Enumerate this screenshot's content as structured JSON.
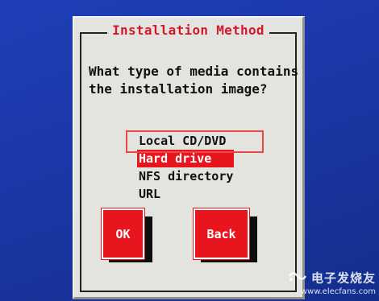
{
  "dialog": {
    "title": "Installation Method",
    "prompt_line1": "What type of media contains",
    "prompt_line2": "the installation image?",
    "options": [
      {
        "label": "Local CD/DVD",
        "selected": false
      },
      {
        "label": "Hard drive",
        "selected": true
      },
      {
        "label": "NFS directory",
        "selected": false
      },
      {
        "label": "URL",
        "selected": false
      }
    ],
    "ok_label": "OK",
    "back_label": "Back"
  },
  "watermark": {
    "brand": "电子发烧友",
    "url": "www.elecfans.com"
  },
  "colors": {
    "background": "#1a37a6",
    "dialog": "#e3e3df",
    "accent": "#e8151f",
    "annotation": "#ee4545"
  }
}
